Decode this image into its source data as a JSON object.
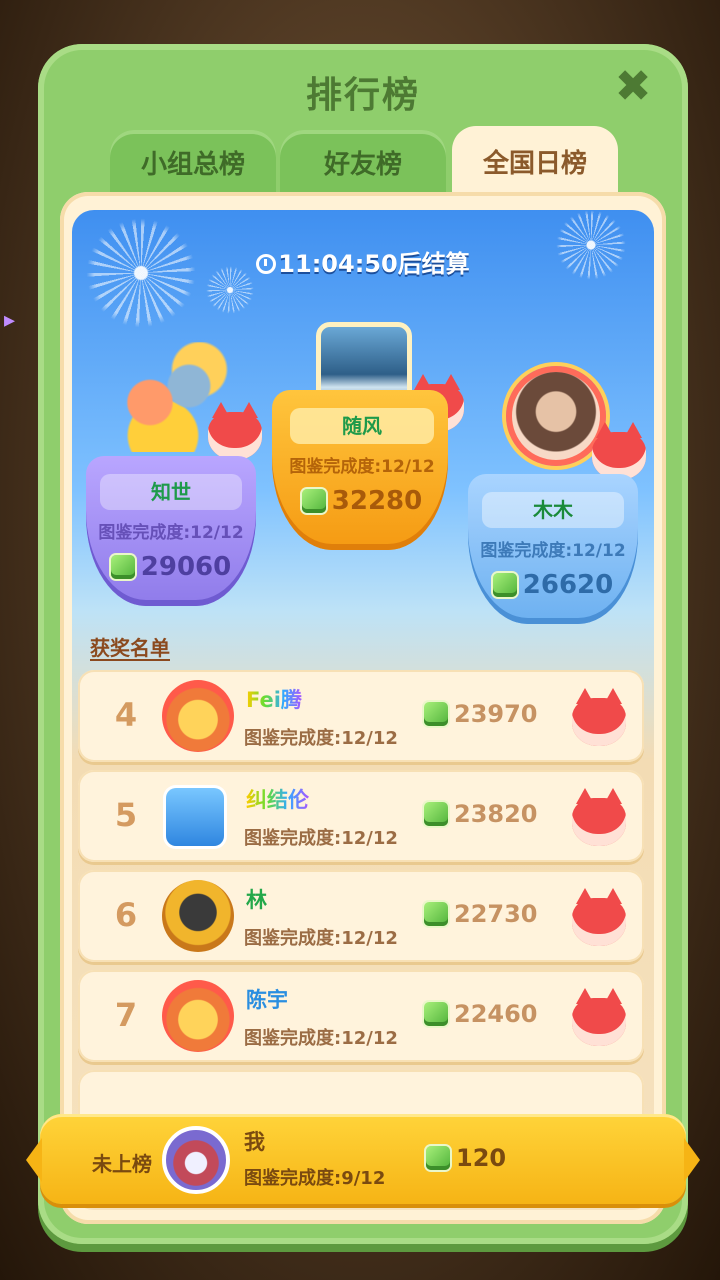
{
  "header": {
    "title": "排行榜"
  },
  "tabs": [
    {
      "label": "小组总榜",
      "active": false
    },
    {
      "label": "好友榜",
      "active": false
    },
    {
      "label": "全国日榜",
      "active": true
    }
  ],
  "timer": {
    "text": "11:04:50后结算"
  },
  "podium": {
    "first": {
      "name": "随风",
      "completion": "图鉴完成度:12/12",
      "score": "32280"
    },
    "second": {
      "name": "知世",
      "completion": "图鉴完成度:12/12",
      "score": "29060"
    },
    "third": {
      "name": "木木",
      "completion": "图鉴完成度:12/12",
      "score": "26620"
    }
  },
  "award_list_title": "获奖名单",
  "ranks": [
    {
      "rank": "4",
      "name": "Fei腾",
      "completion": "图鉴完成度:12/12",
      "score": "23970"
    },
    {
      "rank": "5",
      "name": "纠结伦",
      "completion": "图鉴完成度:12/12",
      "score": "23820"
    },
    {
      "rank": "6",
      "name": "林",
      "completion": "图鉴完成度:12/12",
      "score": "22730"
    },
    {
      "rank": "7",
      "name": "陈宇",
      "completion": "图鉴完成度:12/12",
      "score": "22460"
    }
  ],
  "me": {
    "rank_text": "未上榜",
    "name": "我",
    "completion": "图鉴完成度:9/12",
    "score": "120"
  },
  "colors": {
    "panel_green": "#8fce6c",
    "gold": "#f6b415",
    "gem_green": "#4fb23a"
  },
  "icons": [
    "close-icon",
    "clock-icon",
    "gem-icon",
    "fox-badge-icon"
  ]
}
